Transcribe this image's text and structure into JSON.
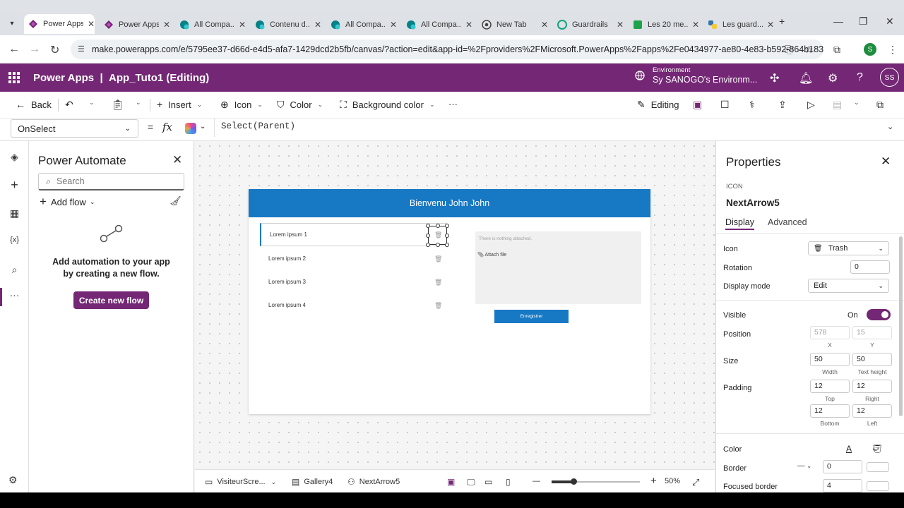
{
  "browser": {
    "tabs": [
      {
        "title": "Power Apps",
        "icon": "powerapps-icon",
        "active": true
      },
      {
        "title": "Power Apps",
        "icon": "powerapps-icon"
      },
      {
        "title": "All Compa...",
        "icon": "sharepoint-icon"
      },
      {
        "title": "Contenu d...",
        "icon": "sharepoint-icon"
      },
      {
        "title": "All Compa...",
        "icon": "sharepoint-icon"
      },
      {
        "title": "All Compa...",
        "icon": "sharepoint-icon"
      },
      {
        "title": "New Tab",
        "icon": "chrome-icon"
      },
      {
        "title": "Guardrails",
        "icon": "openai-icon"
      },
      {
        "title": "Les 20 me...",
        "icon": "site-icon"
      },
      {
        "title": "Les guard...",
        "icon": "python-icon"
      }
    ],
    "url": "make.powerapps.com/e/5795ee37-d66d-e4d5-afa7-1429dcd2b5fb/canvas/?action=edit&app-id=%2Fproviders%2FMicrosoft.PowerApps%2Fapps%2Fe0434977-ae80-4e83-b592-864b183...",
    "profile_initial": "S"
  },
  "header": {
    "product": "Power Apps",
    "separator": "|",
    "app_name": "App_Tuto1 (Editing)",
    "env_label": "Environment",
    "env_name": "Sy SANOGO's Environm...",
    "avatar": "SS"
  },
  "commandbar": {
    "back": "Back",
    "insert": "Insert",
    "icon": "Icon",
    "color": "Color",
    "background_color": "Background color",
    "more": "···",
    "editing": "Editing"
  },
  "formula": {
    "property": "OnSelect",
    "eq": "=",
    "fx": "fx",
    "expression": "Select(Parent)"
  },
  "power_automate": {
    "title": "Power Automate",
    "search_placeholder": "Search",
    "add_flow": "Add flow",
    "message": "Add automation to your app by creating a new flow.",
    "create_button": "Create new flow"
  },
  "canvas": {
    "header_title": "Bienvenu John John",
    "gallery_items": [
      "Lorem ipsum 1",
      "Lorem ipsum 2",
      "Lorem ipsum 3",
      "Lorem ipsum 4"
    ],
    "attach_empty": "There is nothing attached.",
    "attach_file": "Attach file",
    "save_button": "Enregistrer"
  },
  "bottombar": {
    "screen": "VisiteurScre...",
    "gallery": "Gallery4",
    "control": "NextArrow5",
    "zoom": "50%",
    "zoom_fraction": 0.25
  },
  "properties": {
    "title": "Properties",
    "control_type": "ICON",
    "control_name": "NextArrow5",
    "tab_display": "Display",
    "tab_advanced": "Advanced",
    "icon_label": "Icon",
    "icon_value": "Trash",
    "rotation_label": "Rotation",
    "rotation_value": "0",
    "display_mode_label": "Display mode",
    "display_mode_value": "Edit",
    "visible_label": "Visible",
    "visible_value": "On",
    "position_label": "Position",
    "pos_x": "578",
    "pos_y": "15",
    "x_label": "X",
    "y_label": "Y",
    "size_label": "Size",
    "width": "50",
    "text_height": "50",
    "width_label": "Width",
    "text_height_label": "Text height",
    "padding_label": "Padding",
    "pad_top": "12",
    "pad_right": "12",
    "pad_bottom": "12",
    "pad_left": "12",
    "top_label": "Top",
    "right_label": "Right",
    "bottom_label": "Bottom",
    "left_label": "Left",
    "color_label": "Color",
    "color_glyph": "A",
    "border_label": "Border",
    "border_style": "—",
    "border_width": "0",
    "focused_border_label": "Focused border",
    "focused_border_width": "4"
  },
  "colors": {
    "brand": "#742774",
    "canvas_header": "#1778c3",
    "tab_strip": "#dee1e6"
  }
}
